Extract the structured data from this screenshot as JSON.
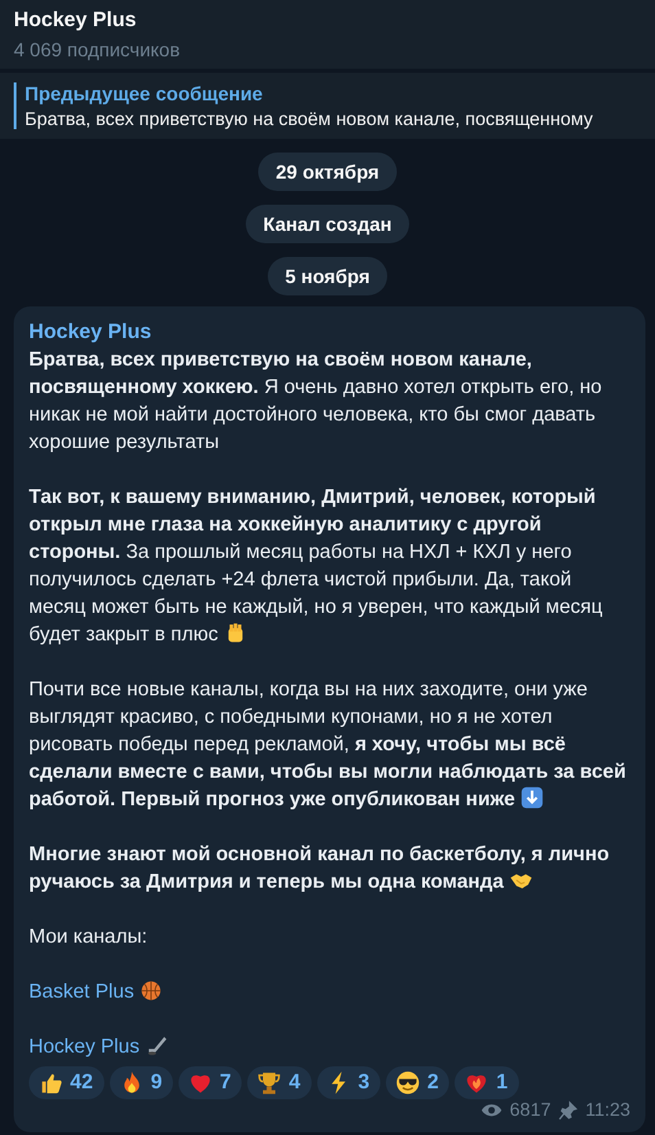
{
  "header": {
    "title": "Hockey Plus",
    "subtitle": "4 069 подписчиков"
  },
  "pinned": {
    "label": "Предыдущее сообщение",
    "text": "Братва, всех приветствую на своём новом канале, посвященному"
  },
  "service": [
    {
      "text": "29 октября"
    },
    {
      "text": "Канал создан"
    },
    {
      "text": "5 ноября"
    }
  ],
  "post": {
    "author": "Hockey Plus",
    "paragraphs": [
      {
        "kind": "mixed",
        "text": "**Братва, всех приветствую на своём новом канале, посвященному хоккею.** Я очень давно хотел открыть его, но никак не мой найти достойного человека, кто бы смог давать хорошие результаты"
      },
      {
        "kind": "mixed",
        "text": "**Так вот, к вашему вниманию, Дмитрий, человек, который открыл мне глаза на хоккейную аналитику с другой стороны.** За прошлый месяц работы на НХЛ + КХЛ у него получилось сделать +24 флета чистой прибыли. Да, такой месяц может быть не каждый, но я уверен, что каждый месяц будет закрыт в плюс"
      },
      {
        "kind": "mixed",
        "text": "Почти все новые каналы, когда вы на них заходите, они уже выглядят красиво, с победными купонами, но я не хотел рисовать победы перед рекламой, **я хочу, чтобы мы всё сделали вместе с вами, чтобы вы могли наблюдать за всей работой. Первый прогноз уже опубликован ниже**"
      },
      {
        "kind": "bold",
        "text": "Многие знают мой основной канал по баскетболу, я лично ручаюсь за Дмитрия и теперь мы одна команда"
      },
      {
        "kind": "plain",
        "text": "Мои каналы:"
      }
    ],
    "links": [
      {
        "text": "Basket Plus"
      },
      {
        "text": "Hockey Plus"
      }
    ],
    "reactions": [
      {
        "count": "42"
      },
      {
        "count": "9"
      },
      {
        "count": "7"
      },
      {
        "count": "4"
      },
      {
        "count": "3"
      },
      {
        "count": "2"
      },
      {
        "count": "1"
      }
    ],
    "views": "6817",
    "time": "11:23"
  }
}
